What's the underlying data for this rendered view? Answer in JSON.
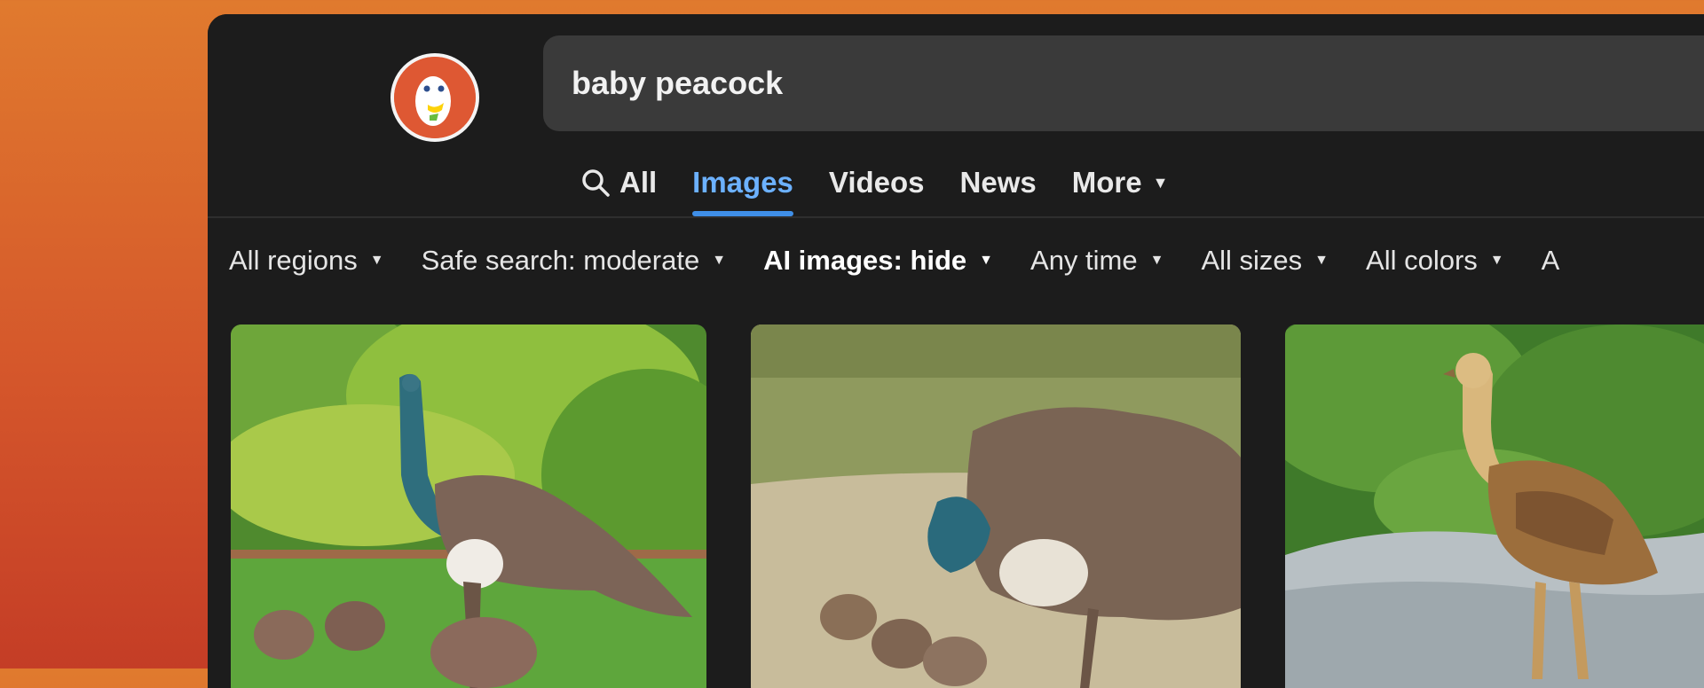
{
  "search": {
    "query": "baby peacock"
  },
  "tabs": [
    {
      "label": "All",
      "icon": "search-icon"
    },
    {
      "label": "Images",
      "active": true
    },
    {
      "label": "Videos"
    },
    {
      "label": "News"
    },
    {
      "label": "More",
      "icon": "caret-down-icon"
    }
  ],
  "filters": [
    {
      "label": "All regions"
    },
    {
      "label": "Safe search: moderate"
    },
    {
      "label": "AI images: hide",
      "emphasis": "bold"
    },
    {
      "label": "Any time"
    },
    {
      "label": "All sizes"
    },
    {
      "label": "All colors"
    },
    {
      "label": "A"
    }
  ],
  "results": [
    {
      "depicts": "peahen-with-chicks-on-lawn"
    },
    {
      "depicts": "peahen-feeding-chicks"
    },
    {
      "depicts": "peacock-chick-on-rock"
    }
  ],
  "colors": {
    "accent": "#3f8fe8",
    "brand": "#de5833",
    "panel": "#1c1c1c",
    "search_bg": "#3a3a3a"
  }
}
